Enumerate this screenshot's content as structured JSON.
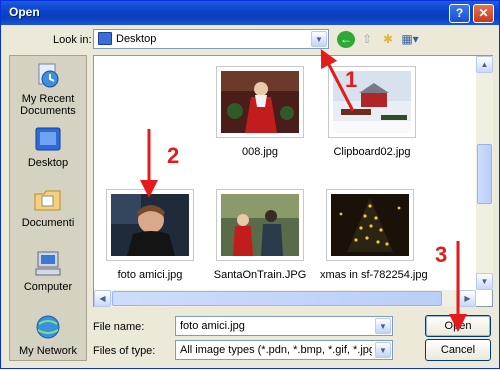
{
  "window": {
    "title": "Open"
  },
  "toolbar": {
    "lookin_label": "Look in:",
    "lookin_value": "Desktop"
  },
  "places": [
    {
      "label": "My Recent Documents",
      "icon": "recent-documents-icon"
    },
    {
      "label": "Desktop",
      "icon": "desktop-icon"
    },
    {
      "label": "Documenti",
      "icon": "documents-folder-icon"
    },
    {
      "label": "Computer",
      "icon": "computer-icon"
    },
    {
      "label": "My Network",
      "icon": "network-icon"
    }
  ],
  "files": [
    {
      "name": "008.jpg"
    },
    {
      "name": "Clipboard02.jpg"
    },
    {
      "name": "foto amici.jpg"
    },
    {
      "name": "SantaOnTrain.JPG"
    },
    {
      "name": "xmas in sf-782254.jpg"
    }
  ],
  "form": {
    "file_name_label": "File name:",
    "file_name_value": "foto amici.jpg",
    "file_type_label": "Files of type:",
    "file_type_value": "All image types (*.pdn, *.bmp, *.gif, *.jpg, *.jpeg,"
  },
  "buttons": {
    "open": "Open",
    "cancel": "Cancel"
  },
  "annotations": {
    "one": "1",
    "two": "2",
    "three": "3"
  },
  "colors": {
    "annotation": "#e41b1b",
    "titlebar": "#0b45c9"
  }
}
